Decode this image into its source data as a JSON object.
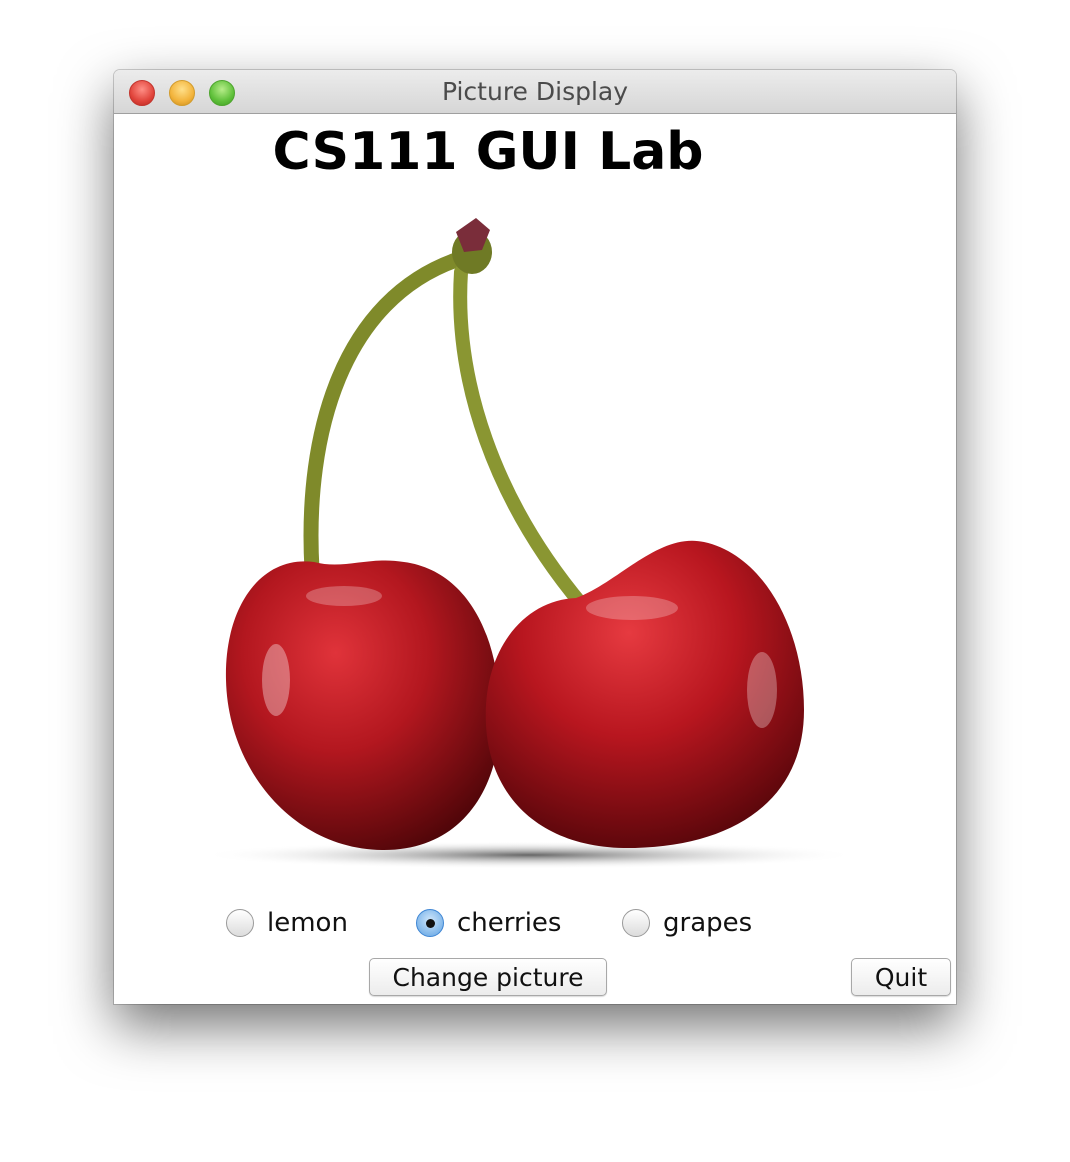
{
  "window": {
    "title": "Picture Display"
  },
  "content": {
    "heading": "CS111 GUI Lab",
    "picture_icon": "cherries-picture"
  },
  "options": [
    {
      "label": "lemon",
      "selected": false
    },
    {
      "label": "cherries",
      "selected": true
    },
    {
      "label": "grapes",
      "selected": false
    }
  ],
  "buttons": {
    "change_picture": "Change picture",
    "quit": "Quit"
  },
  "colors": {
    "cherry_red": "#b3171f",
    "stem_green": "#7f8a2a",
    "selected_radio": "#6ea8e4"
  }
}
